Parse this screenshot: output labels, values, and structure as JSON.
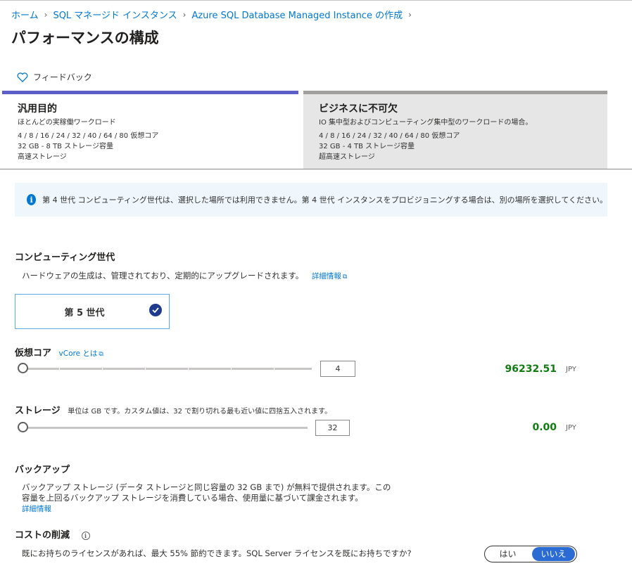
{
  "breadcrumb": [
    {
      "label": "ホーム"
    },
    {
      "label": "SQL マネージド インスタンス"
    },
    {
      "label": "Azure SQL Database Managed Instance の作成"
    }
  ],
  "page_title": "パフォーマンスの構成",
  "feedback_label": "フィードバック",
  "tiers": {
    "general": {
      "title": "汎用目的",
      "line1": "ほとんどの実稼働ワークロード",
      "line2": "4 / 8 / 16 / 24 / 32 / 40 / 64 / 80 仮想コア",
      "line3": "32 GB - 8 TB ストレージ容量",
      "line4": "高速ストレージ"
    },
    "critical": {
      "title": "ビジネスに不可欠",
      "line1": "IO 集中型およびコンピューティング集中型のワークロードの場合。",
      "line2": "4 / 8 / 16 / 24 / 32 / 40 / 64 / 80 仮想コア",
      "line3": "32 GB - 4 TB ストレージ容量",
      "line4": "超高速ストレージ"
    }
  },
  "info_message": "第 4 世代 コンピューティング世代は、選択した場所では利用できません。第 4 世代 インスタンスをプロビジョニングする場合は、別の場所を選択してください。",
  "compute": {
    "title": "コンピューティング世代",
    "desc": "ハードウェアの生成は、管理されており、定期的にアップグレードされます。",
    "link": "詳細情報",
    "card_label": "第 5 世代"
  },
  "vcore": {
    "title": "仮想コア",
    "link": "vCore とは",
    "value": "4",
    "price": "96232.51",
    "currency": "JPY"
  },
  "storage": {
    "title": "ストレージ",
    "note": "単位は GB です。カスタム値は、32 で割り切れる最も近い値に四捨五入されます。",
    "value": "32",
    "price": "0.00",
    "currency": "JPY"
  },
  "backup": {
    "title": "バックアップ",
    "line1": "バックアップ ストレージ (データ ストレージと同じ容量の 32 GB まで) が無料で提供されます。この",
    "line2": "容量を上回るバックアップ ストレージを消費している場合、使用量に基づいて課金されます。",
    "link": "詳細情報"
  },
  "cost": {
    "title": "コストの削減",
    "question": "既にお持ちのライセンスがあれば、最大 55% 節約できます。SQL Server ライセンスを既にお持ちですか?",
    "yes": "はい",
    "no": "いいえ"
  },
  "colors": {
    "accent": "#0078d4",
    "tier_selected": "#5b5fc7",
    "price_green": "#107c10"
  }
}
